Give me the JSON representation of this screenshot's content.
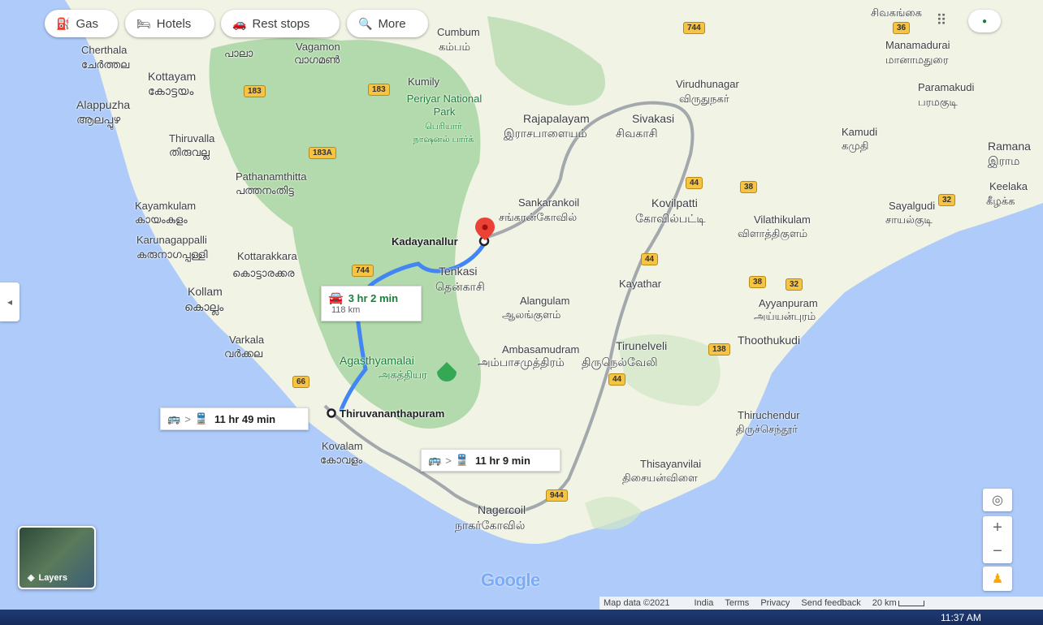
{
  "toolbar": {
    "gas": "Gas",
    "hotels": "Hotels",
    "rest_stops": "Rest stops",
    "more": "More"
  },
  "places": {
    "cherthala": [
      "Cherthala",
      "ചേർത്തല"
    ],
    "kottayam": [
      "Kottayam",
      "കോട്ടയം"
    ],
    "alappuzha": [
      "Alappuzha",
      "ആലപ്പുഴ"
    ],
    "thiruvalla": [
      "Thiruvalla",
      "തിരുവല്ല"
    ],
    "pathanamthitta": [
      "Pathanamthitta",
      "പത്തനംതിട്ട"
    ],
    "kayamkulam": [
      "Kayamkulam",
      "കായംകുളം"
    ],
    "karunagappalli": [
      "Karunagappalli",
      "കരുനാഗപ്പള്ളി"
    ],
    "kottarakkara": [
      "Kottarakkara",
      "കൊട്ടാരക്കര"
    ],
    "kollam": [
      "Kollam",
      "കൊല്ലം"
    ],
    "varkala": [
      "Varkala",
      "വർക്കല"
    ],
    "kovalam": [
      "Kovalam",
      "കോവളം"
    ],
    "pala": [
      "",
      "പാലാ"
    ],
    "vagamon": [
      "Vagamon",
      "വാഗമൺ"
    ],
    "cumbum": [
      "Cumbum",
      "கம்பம்"
    ],
    "kumily": [
      "Kumily",
      ""
    ],
    "periyar": [
      "Periyar National Park",
      "பெரியார் நாஷனல் பார்க்"
    ],
    "rajapalayam": [
      "Rajapalayam",
      "இராசபாளையம்"
    ],
    "sivakasi": [
      "Sivakasi",
      "சிவகாசி"
    ],
    "virudhunagar": [
      "Virudhunagar",
      "விருதுநகர்"
    ],
    "sivaganga": [
      "",
      "சிவகங்கை"
    ],
    "manamadurai": [
      "Manamadurai",
      "மானாமதுரை"
    ],
    "paramakudi": [
      "Paramakudi",
      "பரமகுடி"
    ],
    "kamudi": [
      "Kamudi",
      "கமுதி"
    ],
    "ramana": [
      "Ramana",
      "இராம"
    ],
    "keelaka": [
      "Keelaka",
      "கீழக்க"
    ],
    "sayalgudi": [
      "Sayalgudi",
      "சாயல்குடி"
    ],
    "sankarankoil": [
      "Sankarankoil",
      "சங்கரன்கோவில்"
    ],
    "kovilpatti": [
      "Kovilpatti",
      "கோவில்பட்டி"
    ],
    "vilathikulam": [
      "Vilathikulam",
      "விளாத்திகுளம்"
    ],
    "tenkasi": [
      "Tenkasi",
      "தென்காசி"
    ],
    "alangulam": [
      "Alangulam",
      "ஆலங்குளம்"
    ],
    "kayathar": [
      "Kayathar",
      ""
    ],
    "ayyanpuram": [
      "Ayyanpuram",
      "அய்யன்புரம்"
    ],
    "thoothukudi": [
      "Thoothukudi",
      ""
    ],
    "ambasamudram": [
      "Ambasamudram",
      "அம்பாசமுத்திரம்"
    ],
    "tirunelveli": [
      "Tirunelveli",
      "திருநெல்வேலி"
    ],
    "agasthyamalai": [
      "Agasthyamalai",
      "அகத்தியர"
    ],
    "thiruchendur": [
      "Thiruchendur",
      "திருச்செந்தூர்"
    ],
    "thisayanvilai": [
      "Thisayanvilai",
      "திசையன்விளை"
    ],
    "nagercoil": [
      "Nagercoil",
      "நாகர்கோவில்"
    ],
    "kadayanallur": "Kadayanallur",
    "thiruvananthapuram": "Thiruvananthapuram"
  },
  "highways": [
    "744",
    "183",
    "183",
    "183A",
    "744",
    "36",
    "44",
    "38",
    "44",
    "32",
    "44",
    "38",
    "32",
    "138",
    "44",
    "66",
    "944"
  ],
  "routes": {
    "drive": {
      "time": "3 hr 2 min",
      "distance": "118 km"
    },
    "transit_1": {
      "time": "11 hr 49 min",
      "arrow": ">"
    },
    "transit_2": {
      "time": "11 hr 9 min",
      "arrow": ">"
    }
  },
  "layers_label": "Layers",
  "google_logo": "Google",
  "footer": {
    "map_data": "Map data ©2021",
    "country": "India",
    "terms": "Terms",
    "privacy": "Privacy",
    "feedback": "Send feedback",
    "scale": "20 km"
  },
  "clock": "11:37 AM",
  "zoom_in": "+",
  "zoom_out": "−",
  "collapse_arrow": "◂",
  "colors": {
    "route": "#4285f4",
    "transit_route": "#9aa0a6",
    "sea": "#aecbfa",
    "land": "#f1f3e4",
    "forest": "#a8d5a2",
    "pin": "#ea4335"
  }
}
